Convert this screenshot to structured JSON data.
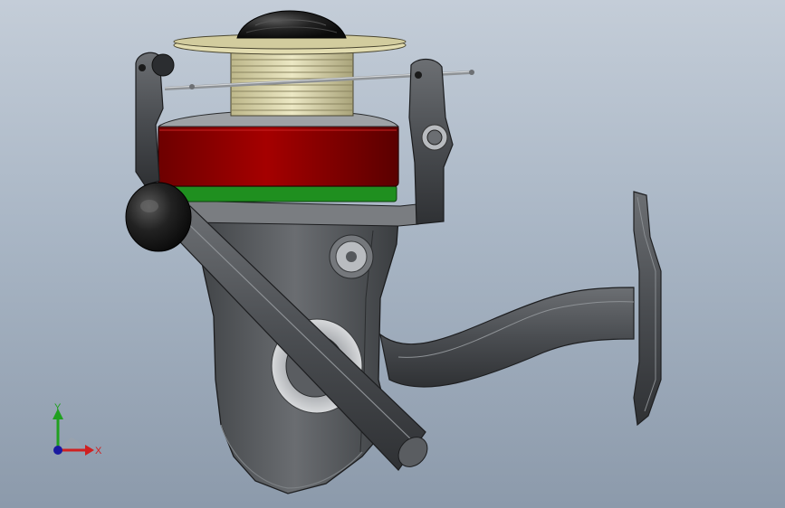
{
  "viewport": {
    "background_top": "#c4cdd8",
    "background_bottom": "#8c9aab"
  },
  "model": {
    "body_color": "#55585c",
    "rotor_color": "#8b0000",
    "ring_color": "#1f8f1f",
    "spool_color": "#d9d4a8",
    "knob_color": "#1b1b1b"
  },
  "triad": {
    "x_label": "X",
    "y_label": "Y",
    "x_color": "#d02020",
    "y_color": "#20a020",
    "z_color": "#1a1aa0"
  }
}
